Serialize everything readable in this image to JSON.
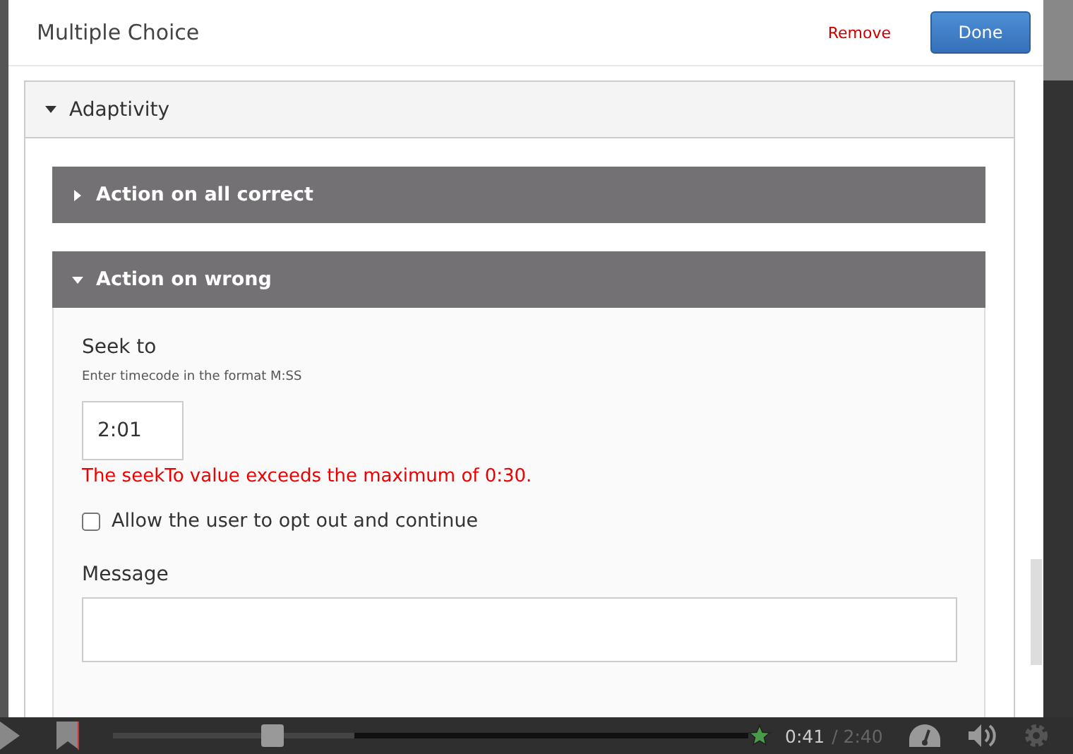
{
  "dialog": {
    "title": "Multiple Choice",
    "remove": "Remove",
    "done": "Done"
  },
  "section": {
    "title": "Adaptivity",
    "expanded": true,
    "panels": [
      {
        "title": "Action on all correct",
        "expanded": false
      },
      {
        "title": "Action on wrong",
        "expanded": true,
        "seek_label": "Seek to",
        "seek_hint": "Enter timecode in the format M:SS",
        "seek_value": "2:01",
        "error": "The seekTo value exceeds the maximum of 0:30.",
        "opt_out": {
          "label": "Allow the user to opt out and continue",
          "checked": false
        },
        "message_label": "Message"
      }
    ]
  },
  "player": {
    "level": 0.25,
    "time_current": "0:41",
    "time_total": "/ 2:40"
  }
}
